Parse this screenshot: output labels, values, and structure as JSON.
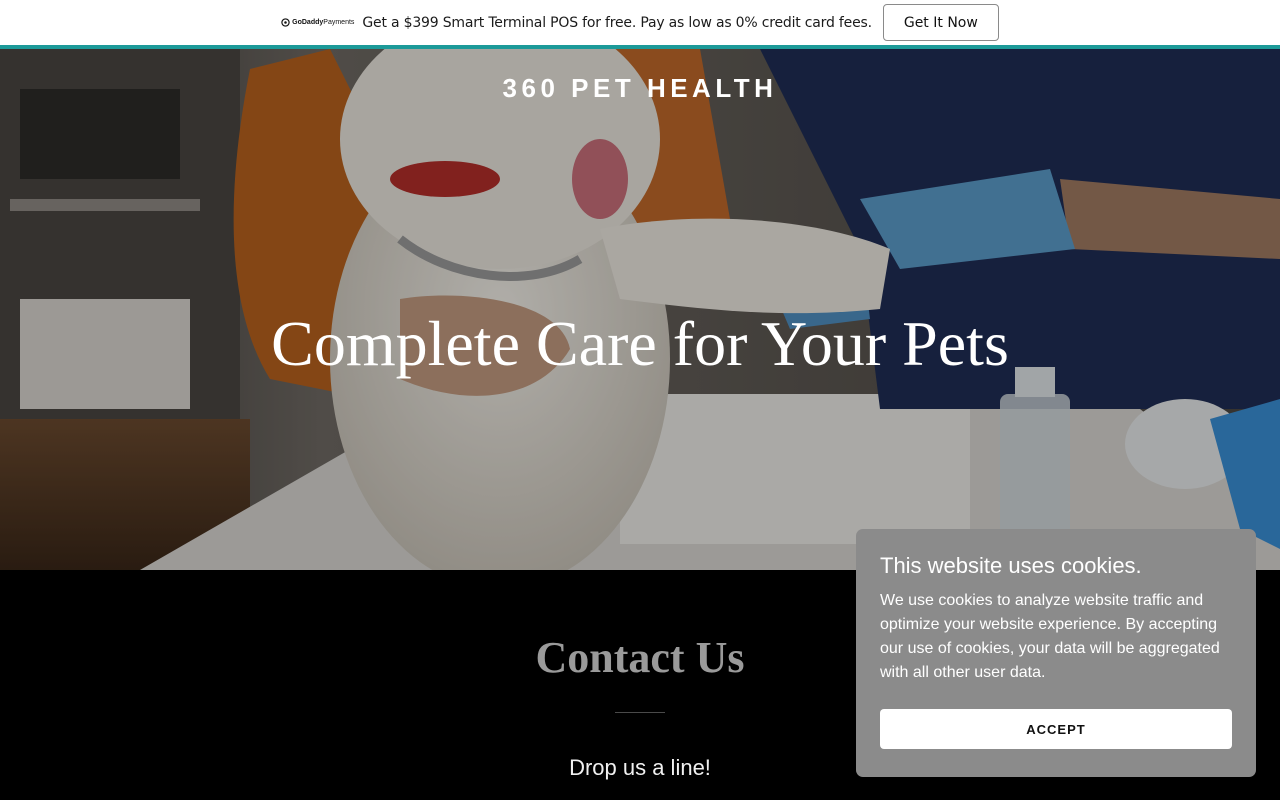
{
  "promo": {
    "brand_main": "GoDaddy",
    "brand_sub": "Payments",
    "text": "Get a $399 Smart Terminal POS for free. Pay as low as 0% credit card fees.",
    "button_label": "Get It Now",
    "accent_color": "#1c9a99"
  },
  "header": {
    "site_title": "360 PET HEALTH"
  },
  "hero": {
    "heading": "Complete Care for Your Pets"
  },
  "contact": {
    "title": "Contact Us",
    "subtitle": "Drop us a line!"
  },
  "cookie": {
    "title": "This website uses cookies.",
    "body": "We use cookies to analyze website traffic and optimize your website experience. By accepting our use of cookies, your data will be aggregated with all other user data.",
    "accept_label": "ACCEPT",
    "background": "#8b8b8b"
  }
}
